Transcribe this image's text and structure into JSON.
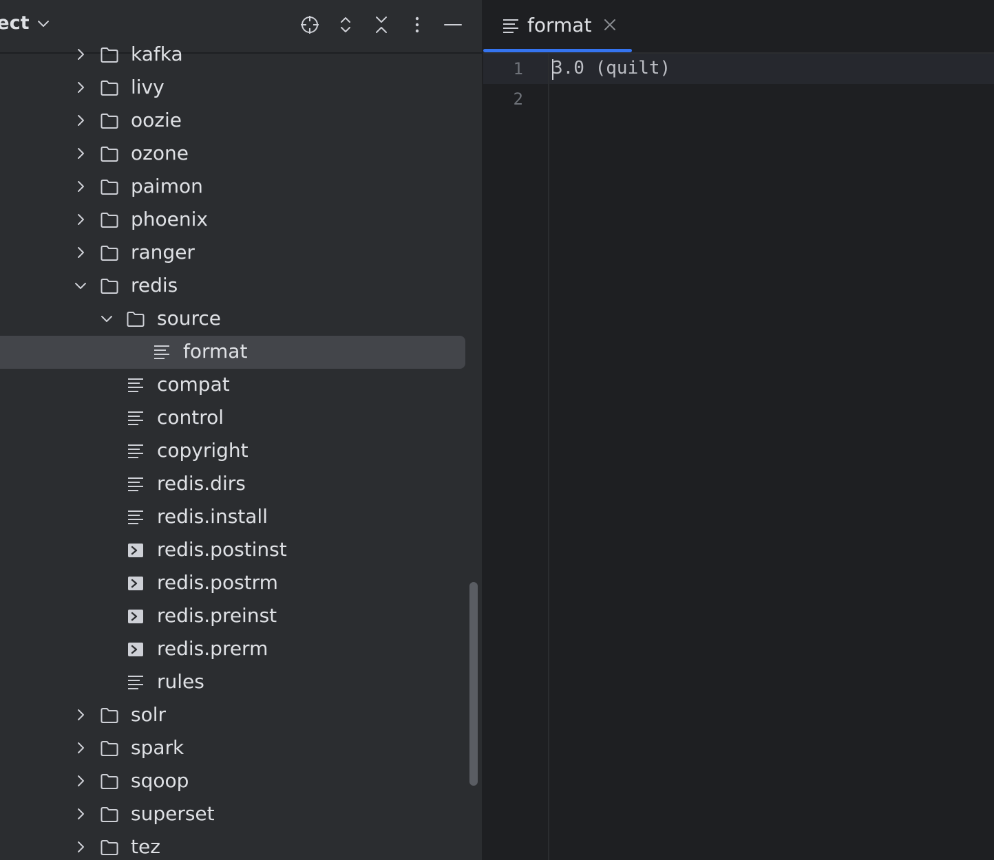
{
  "project_panel": {
    "title": "ject",
    "tree": [
      {
        "label": "kafka",
        "type": "folder",
        "depth": 0,
        "expanded": false
      },
      {
        "label": "livy",
        "type": "folder",
        "depth": 0,
        "expanded": false
      },
      {
        "label": "oozie",
        "type": "folder",
        "depth": 0,
        "expanded": false
      },
      {
        "label": "ozone",
        "type": "folder",
        "depth": 0,
        "expanded": false
      },
      {
        "label": "paimon",
        "type": "folder",
        "depth": 0,
        "expanded": false
      },
      {
        "label": "phoenix",
        "type": "folder",
        "depth": 0,
        "expanded": false
      },
      {
        "label": "ranger",
        "type": "folder",
        "depth": 0,
        "expanded": false
      },
      {
        "label": "redis",
        "type": "folder",
        "depth": 0,
        "expanded": true
      },
      {
        "label": "source",
        "type": "folder",
        "depth": 1,
        "expanded": true
      },
      {
        "label": "format",
        "type": "text",
        "depth": 2,
        "selected": true
      },
      {
        "label": "compat",
        "type": "text",
        "depth": 1
      },
      {
        "label": "control",
        "type": "text",
        "depth": 1
      },
      {
        "label": "copyright",
        "type": "text",
        "depth": 1
      },
      {
        "label": "redis.dirs",
        "type": "text",
        "depth": 1
      },
      {
        "label": "redis.install",
        "type": "text",
        "depth": 1
      },
      {
        "label": "redis.postinst",
        "type": "script",
        "depth": 1
      },
      {
        "label": "redis.postrm",
        "type": "script",
        "depth": 1
      },
      {
        "label": "redis.preinst",
        "type": "script",
        "depth": 1
      },
      {
        "label": "redis.prerm",
        "type": "script",
        "depth": 1
      },
      {
        "label": "rules",
        "type": "text",
        "depth": 1
      },
      {
        "label": "solr",
        "type": "folder",
        "depth": 0,
        "expanded": false
      },
      {
        "label": "spark",
        "type": "folder",
        "depth": 0,
        "expanded": false
      },
      {
        "label": "sqoop",
        "type": "folder",
        "depth": 0,
        "expanded": false
      },
      {
        "label": "superset",
        "type": "folder",
        "depth": 0,
        "expanded": false
      },
      {
        "label": "tez",
        "type": "folder",
        "depth": 0,
        "expanded": false
      }
    ]
  },
  "editor": {
    "tab": {
      "label": "format",
      "icon": "text-file-icon"
    },
    "line_numbers": [
      "1",
      "2"
    ],
    "lines": [
      "3.0 (quilt)",
      ""
    ]
  },
  "colors": {
    "panel_bg": "#2b2d30",
    "editor_bg": "#1e1f22",
    "selection": "#43454a",
    "accent": "#3574f0",
    "icon": "#ced0d6"
  }
}
